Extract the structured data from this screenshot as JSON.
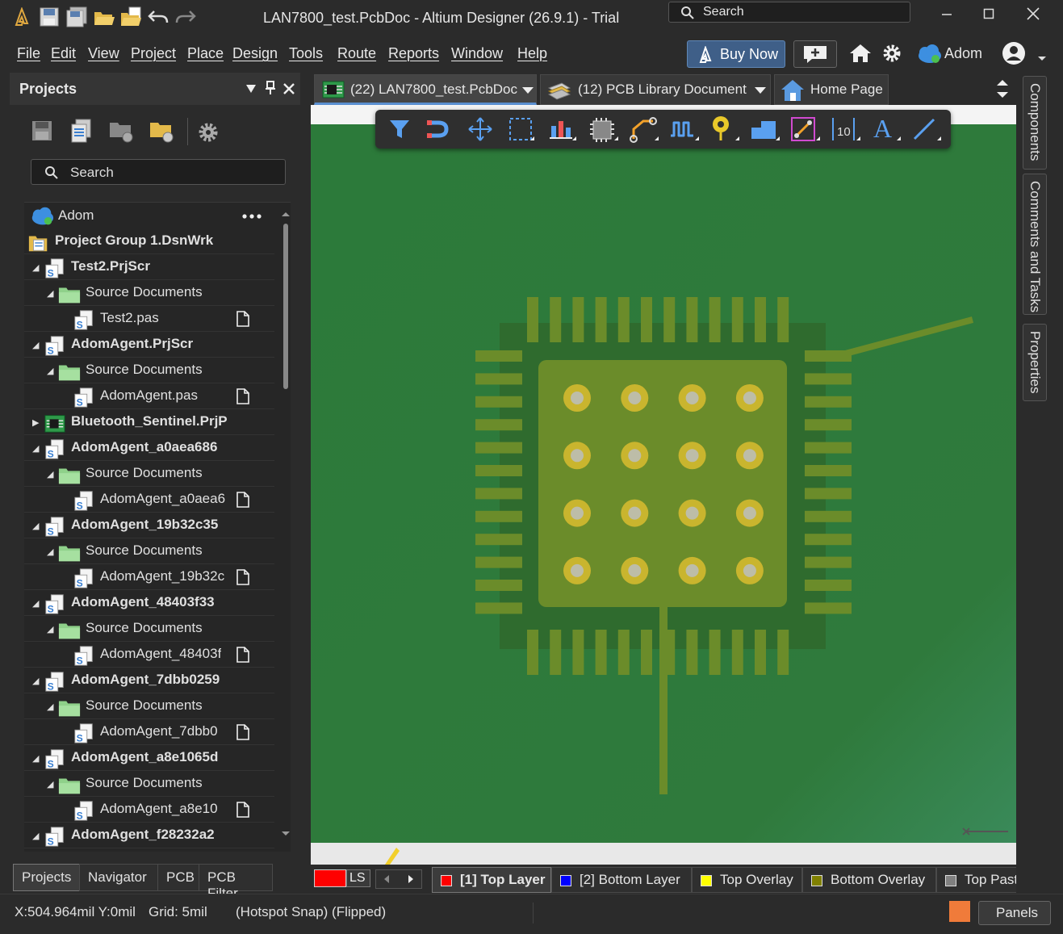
{
  "window": {
    "title": "LAN7800_test.PcbDoc - Altium Designer (26.9.1) - Trial",
    "search_placeholder": "Search"
  },
  "menu": {
    "items": [
      "File",
      "Edit",
      "View",
      "Project",
      "Place",
      "Design",
      "Tools",
      "Route",
      "Reports",
      "Window",
      "Help"
    ],
    "buy_now": "Buy Now",
    "account": "Adom"
  },
  "projects_panel": {
    "title": "Projects",
    "search_placeholder": "Search",
    "cloud_label": "Adom",
    "tree": [
      {
        "label": "Project Group 1.DsnWrk",
        "level": 0,
        "type": "group",
        "bold": true
      },
      {
        "label": "Test2.PrjScr",
        "level": 1,
        "type": "project",
        "bold": true,
        "expanded": true
      },
      {
        "label": "Source Documents",
        "level": 2,
        "type": "folder",
        "expanded": true
      },
      {
        "label": "Test2.pas",
        "level": 3,
        "type": "file"
      },
      {
        "label": "AdomAgent.PrjScr",
        "level": 1,
        "type": "project",
        "bold": true,
        "expanded": true
      },
      {
        "label": "Source Documents",
        "level": 2,
        "type": "folder",
        "expanded": true
      },
      {
        "label": "AdomAgent.pas",
        "level": 3,
        "type": "file"
      },
      {
        "label": "Bluetooth_Sentinel.PrjP",
        "level": 1,
        "type": "pcbproject",
        "bold": true,
        "expanded": false
      },
      {
        "label": "AdomAgent_a0aea686",
        "level": 1,
        "type": "project",
        "bold": true,
        "expanded": true
      },
      {
        "label": "Source Documents",
        "level": 2,
        "type": "folder",
        "expanded": true
      },
      {
        "label": "AdomAgent_a0aea6",
        "level": 3,
        "type": "file"
      },
      {
        "label": "AdomAgent_19b32c35",
        "level": 1,
        "type": "project",
        "bold": true,
        "expanded": true
      },
      {
        "label": "Source Documents",
        "level": 2,
        "type": "folder",
        "expanded": true
      },
      {
        "label": "AdomAgent_19b32c",
        "level": 3,
        "type": "file"
      },
      {
        "label": "AdomAgent_48403f33",
        "level": 1,
        "type": "project",
        "bold": true,
        "expanded": true
      },
      {
        "label": "Source Documents",
        "level": 2,
        "type": "folder",
        "expanded": true
      },
      {
        "label": "AdomAgent_48403f",
        "level": 3,
        "type": "file"
      },
      {
        "label": "AdomAgent_7dbb0259",
        "level": 1,
        "type": "project",
        "bold": true,
        "expanded": true
      },
      {
        "label": "Source Documents",
        "level": 2,
        "type": "folder",
        "expanded": true
      },
      {
        "label": "AdomAgent_7dbb0",
        "level": 3,
        "type": "file"
      },
      {
        "label": "AdomAgent_a8e1065d",
        "level": 1,
        "type": "project",
        "bold": true,
        "expanded": true
      },
      {
        "label": "Source Documents",
        "level": 2,
        "type": "folder",
        "expanded": true
      },
      {
        "label": "AdomAgent_a8e10",
        "level": 3,
        "type": "file"
      },
      {
        "label": "AdomAgent_f28232a2",
        "level": 1,
        "type": "project",
        "bold": true,
        "expanded": true
      }
    ],
    "bottom_tabs": [
      "Projects",
      "Navigator",
      "PCB",
      "PCB Filter"
    ]
  },
  "doc_tabs": [
    {
      "label": "(22) LAN7800_test.PcbDoc",
      "active": true,
      "icon": "pcb-doc-icon"
    },
    {
      "label": "(12) PCB Library Document",
      "active": false,
      "icon": "pcb-library-icon"
    },
    {
      "label": "Home Page",
      "active": false,
      "icon": "home-icon"
    }
  ],
  "side_panels": [
    "Components",
    "Comments and Tasks",
    "Properties"
  ],
  "layer_bar": {
    "ls_label": "LS",
    "layers": [
      {
        "label": "[1] Top Layer",
        "color": "#ff0000",
        "active": true
      },
      {
        "label": "[2] Bottom Layer",
        "color": "#0000ff",
        "active": false
      },
      {
        "label": "Top Overlay",
        "color": "#ffff00",
        "active": false
      },
      {
        "label": "Bottom Overlay",
        "color": "#808000",
        "active": false
      },
      {
        "label": "Top Paste",
        "color": "#808080",
        "active": false
      }
    ]
  },
  "status": {
    "coords": "X:504.964mil Y:0mil",
    "grid": "Grid: 5mil",
    "snap": "(Hotspot Snap) (Flipped)",
    "panels": "Panels"
  },
  "colors": {
    "board": "#2e7a3a",
    "component_body": "#2f6b2e",
    "pad": "#6b8c2a",
    "via_ring": "#c9b52e",
    "accent": "#5a8fd0"
  }
}
